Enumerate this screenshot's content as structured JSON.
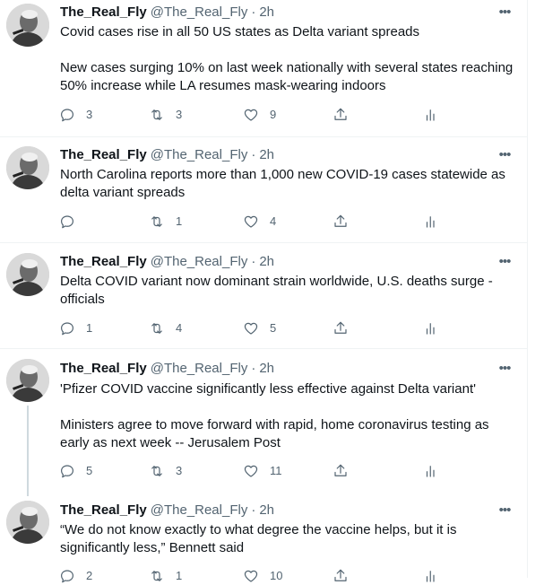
{
  "colors": {
    "text_primary": "#0f1419",
    "text_secondary": "#536471",
    "divider": "#eff3f4",
    "thread_line": "#cfd9de"
  },
  "icons": {
    "reply": "reply-icon",
    "retweet": "retweet-icon",
    "like": "heart-icon",
    "share": "share-icon",
    "stats": "analytics-icon",
    "more": "more-icon"
  },
  "tweets": [
    {
      "name": "The_Real_Fly",
      "handle": "@The_Real_Fly",
      "separator": "·",
      "time": "2h",
      "more": "•••",
      "text": [
        "Covid cases rise in all 50 US states as Delta variant spreads",
        "New cases surging 10% on last week nationally with several states reaching 50% increase while LA resumes mask-wearing indoors"
      ],
      "replies": "3",
      "retweets": "3",
      "likes": "9"
    },
    {
      "name": "The_Real_Fly",
      "handle": "@The_Real_Fly",
      "separator": "·",
      "time": "2h",
      "more": "•••",
      "text": [
        "North Carolina reports more than 1,000 new COVID-19 cases statewide as delta variant spreads"
      ],
      "replies": "",
      "retweets": "1",
      "likes": "4"
    },
    {
      "name": "The_Real_Fly",
      "handle": "@The_Real_Fly",
      "separator": "·",
      "time": "2h",
      "more": "•••",
      "text": [
        "Delta COVID variant now dominant strain worldwide, U.S. deaths surge - officials"
      ],
      "replies": "1",
      "retweets": "4",
      "likes": "5"
    },
    {
      "name": "The_Real_Fly",
      "handle": "@The_Real_Fly",
      "separator": "·",
      "time": "2h",
      "more": "•••",
      "text": [
        "'Pfizer COVID vaccine significantly less effective against Delta variant'",
        "Ministers agree to move forward with rapid, home coronavirus testing as early as next week -- Jerusalem Post"
      ],
      "replies": "5",
      "retweets": "3",
      "likes": "11"
    },
    {
      "name": "The_Real_Fly",
      "handle": "@The_Real_Fly",
      "separator": "·",
      "time": "2h",
      "more": "•••",
      "text": [
        "“We do not know exactly to what degree the vaccine helps, but it is significantly less,” Bennett said"
      ],
      "replies": "2",
      "retweets": "1",
      "likes": "10"
    }
  ]
}
